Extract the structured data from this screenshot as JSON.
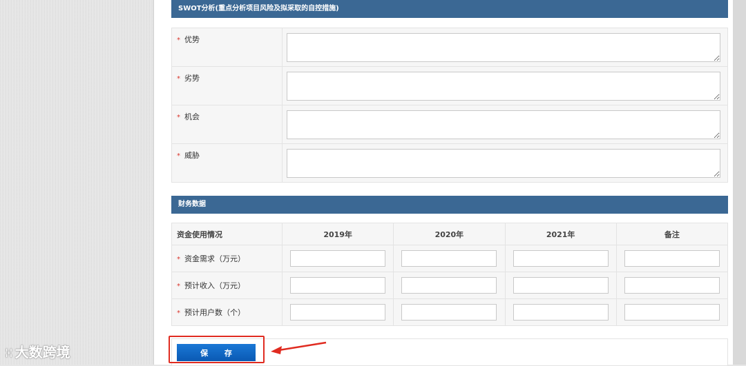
{
  "swot": {
    "title": "SWOT分析(重点分析项目风险及拟采取的自控措施)",
    "required_mark": "*",
    "rows": [
      {
        "label": "优势"
      },
      {
        "label": "劣势"
      },
      {
        "label": "机会"
      },
      {
        "label": "威胁"
      }
    ]
  },
  "finance": {
    "title": "财务数据",
    "columns": [
      "资金使用情况",
      "2019年",
      "2020年",
      "2021年",
      "备注"
    ],
    "rows": [
      {
        "label": "资金需求（万元）"
      },
      {
        "label": "预计收入（万元）"
      },
      {
        "label": "预计用户数（个）"
      }
    ]
  },
  "actions": {
    "save_label": "保 存"
  },
  "watermark": {
    "logo": "ꔘ",
    "text": "大数跨境"
  },
  "colors": {
    "header_bg": "#3b6894",
    "button_bg": "#0a63c2",
    "highlight": "#e02b20",
    "required": "#d9342b"
  }
}
